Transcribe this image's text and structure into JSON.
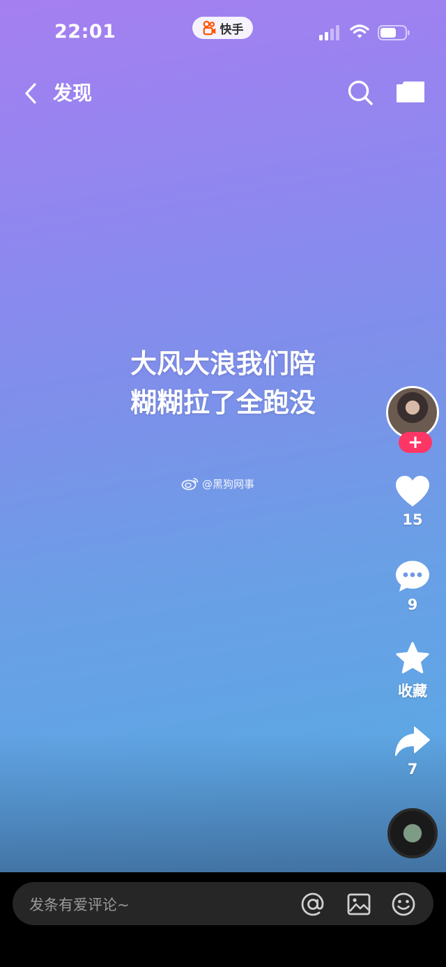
{
  "status_bar": {
    "time": "22:01",
    "app_name": "快手",
    "signal_icon": "cellular-signal-icon",
    "wifi_icon": "wifi-icon",
    "battery_icon": "battery-icon"
  },
  "nav": {
    "title": "发现",
    "back_icon": "chevron-left-icon",
    "search_icon": "search-icon",
    "camera_icon": "camera-icon"
  },
  "video": {
    "caption_line1": "大风大浪我们陪",
    "caption_line2": "糊糊拉了全跑没",
    "watermark": "@黑狗网事"
  },
  "actions": {
    "follow_label": "+",
    "likes": "15",
    "comments": "9",
    "favorite_label": "收藏",
    "shares": "7"
  },
  "comment_bar": {
    "placeholder": "发条有爱评论~",
    "icons": [
      "at-icon",
      "image-icon",
      "emoji-icon"
    ]
  },
  "colors": {
    "accent": "#fe3666",
    "gradient_top": "#a57ff0",
    "gradient_bottom": "#5a9fd8"
  }
}
